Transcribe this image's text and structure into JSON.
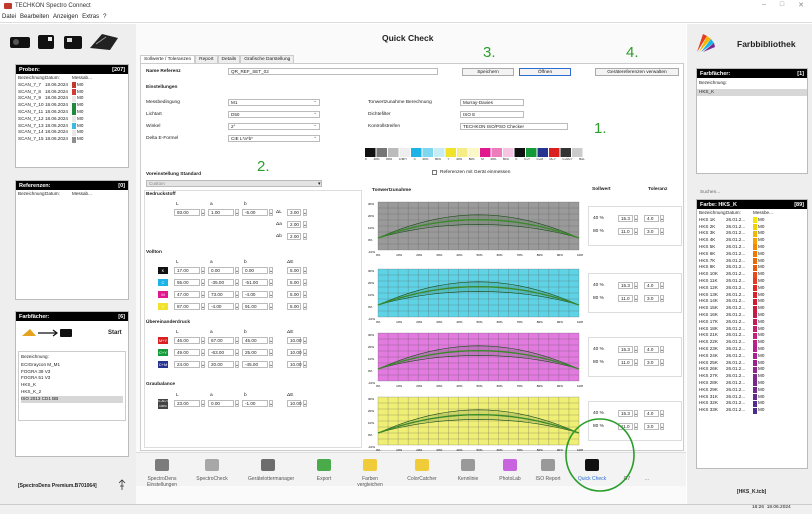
{
  "app": {
    "title": "TECHKON Spectro Connect",
    "menu": [
      "Datei",
      "Bearbeiten",
      "Anzeigen",
      "Extras",
      "?"
    ]
  },
  "left": {
    "probes_header": "Proben:",
    "probes_count": "[207]",
    "cols": [
      "Bezeichnung:",
      "Datum:",
      "Messab..."
    ],
    "probes": [
      [
        "SCAN_7_7",
        "18.06.2024",
        "#c0392b",
        "M0"
      ],
      [
        "SCAN_7_8",
        "18.06.2024",
        "#d23a3a",
        "M0"
      ],
      [
        "SCAN_7_9",
        "18.06.2024",
        "#e8e8e8",
        "M0"
      ],
      [
        "SCAN_7_10",
        "18.06.2024",
        "#1f8a3a",
        "M0"
      ],
      [
        "SCAN_7_11",
        "18.06.2024",
        "#1f8a3a",
        "M0"
      ],
      [
        "SCAN_7_12",
        "18.06.2024",
        "#e8e8e8",
        "M0"
      ],
      [
        "SCAN_7_13",
        "18.06.2024",
        "#3bb9e0",
        "M0"
      ],
      [
        "SCAN_7_14",
        "18.06.2024",
        "#e8e8e8",
        "M0"
      ],
      [
        "SCAN_7_15",
        "18.06.2024",
        "#8f8f8f",
        "M0"
      ]
    ],
    "refs_header": "Referenzen:",
    "refs_count": "[0]",
    "fan_header": "Farbfächer:",
    "fan_count": "[6]",
    "start": "Start",
    "fan_col": "Bezeichnung:",
    "fans": [
      "ECIGraycon M_M1",
      "FOGRA 39 V3",
      "FOGRA 51 V3",
      "HKS_K",
      "HKS_K_2",
      "ISO 2013 CD1 BB"
    ],
    "device": "[SpectroDens Premium.B701064]"
  },
  "main": {
    "title": "Quick Check",
    "tabs": [
      "Sollwerte / Toleranzen",
      "Report",
      "Details",
      "Grafische Darstellung"
    ],
    "name_ref_label": "Name Referenz",
    "name_ref_value": "QR_REF_SET_02",
    "btn_save": "Speichern",
    "btn_open": "Öffnen",
    "btn_device": "Gerätereferenzen verwalten",
    "settings": "Einstellungen",
    "rows": [
      [
        "Messbedingung",
        "M1"
      ],
      [
        "Lichtart",
        "D50"
      ],
      [
        "Winkel",
        "2°"
      ],
      [
        "Delta E-Formel",
        "CIE L*a*b*"
      ]
    ],
    "rrows": [
      [
        "Tonwertzunahme Berechnung",
        "Murray-Davies"
      ],
      [
        "Dichtefilter",
        "ISO E"
      ],
      [
        "Kontrollstreifen",
        "TECHKON ISO/PSO Checker"
      ]
    ],
    "strip_labels": [
      "K",
      "40%",
      "80%",
      "C/M/Y",
      "C",
      "40%",
      "80%",
      "Y",
      "40%",
      "80%",
      "M",
      "40%",
      "80%",
      "K",
      "C+Y",
      "C+M",
      "M+Y",
      "C+M+Y",
      "BAL"
    ],
    "preset_label": "Voreinstellung Standard",
    "preset_value": "Custom",
    "ref_device_check": "Referenzen mit Gerät einmessen",
    "sections": {
      "paper": {
        "title": "Bedruckstoff",
        "cols": [
          "L",
          "a",
          "b"
        ],
        "vals": [
          "93.00",
          "1.00",
          "-5.00"
        ],
        "dl_label": "ΔL",
        "dl": "3.00",
        "da_label": "Δa",
        "da": "2.00",
        "db_label": "Δb",
        "db": "2.00"
      },
      "solid": {
        "title": "Vollton",
        "cols": [
          "L",
          "a",
          "b",
          "ΔE"
        ],
        "rows": [
          [
            "K",
            "17.00",
            "0.00",
            "0.00",
            "5.00",
            "#111111"
          ],
          [
            "C",
            "55.00",
            "-35.00",
            "-51.00",
            "5.00",
            "#1cb4e6"
          ],
          [
            "M",
            "47.00",
            "73.00",
            "-4.00",
            "5.00",
            "#e0198f"
          ],
          [
            "Y",
            "87.00",
            "-4.00",
            "91.00",
            "5.00",
            "#f2e22a"
          ]
        ]
      },
      "over": {
        "title": "Übereinanderdruck",
        "cols": [
          "L",
          "a",
          "b",
          "ΔE"
        ],
        "rows": [
          [
            "M+Y",
            "46.00",
            "67.00",
            "45.00",
            "10.00",
            "#d91f1f"
          ],
          [
            "C+Y",
            "49.00",
            "-63.00",
            "25.00",
            "10.00",
            "#159a3a"
          ],
          [
            "C+M",
            "24.00",
            "20.00",
            "-45.00",
            "10.00",
            "#26338f"
          ]
        ]
      },
      "gray": {
        "title": "Graubalance",
        "cols": [
          "L",
          "a",
          "b",
          "ΔE"
        ],
        "chip": "C+M+Y 100%",
        "vals": [
          "23.00",
          "0.00",
          "-1.00",
          "10.00"
        ]
      }
    },
    "tvz_title": "Tonwertzunahme",
    "sollwert": "Sollwert",
    "toleranz": "Toleranz",
    "tvz": [
      [
        "40 %",
        "15.3",
        "4.0",
        "80 %",
        "11.0",
        "3.0"
      ],
      [
        "40 %",
        "15.3",
        "4.0",
        "80 %",
        "11.0",
        "3.0"
      ],
      [
        "40 %",
        "15.3",
        "4.0",
        "80 %",
        "11.0",
        "3.0"
      ],
      [
        "40 %",
        "15.3",
        "4.0",
        "80 %",
        "11.0",
        "3.0"
      ]
    ],
    "chart_ticks_x": [
      "0%",
      "10%",
      "20%",
      "30%",
      "40%",
      "50%",
      "60%",
      "70%",
      "80%",
      "90%",
      "100%"
    ],
    "chart_ticks_y": [
      "30%",
      "20%",
      "10%",
      "0%",
      "-10%"
    ],
    "chart_colors": [
      "#9a9a9a",
      "#5fd3e6",
      "#e27ae0",
      "#f0ef75"
    ],
    "markers": [
      "1.",
      "2.",
      "3.",
      "4."
    ]
  },
  "toolbar": [
    "SpectroDens Einstellungen",
    "SpectroCheck",
    "Gerätelottermanager",
    "Export",
    "Farben vergleichen",
    "ColorCatcher",
    "Kennlinie",
    "PhotoLab",
    "ISO Report",
    "Quick Check",
    "G7",
    "..."
  ],
  "right": {
    "title": "Farbbibliothek",
    "fan_header": "Farbfächer:",
    "fan_count": "[1]",
    "fan_col": "Bezeichnung:",
    "fan_item": "HKS_K",
    "search_label": "Suchen...",
    "color_header": "Farbe: HKS_K",
    "color_count": "[89]",
    "cols": [
      "Bezeichnung:",
      "Datum:",
      "Messbe..."
    ],
    "colors": [
      [
        "HKS 1K",
        "26.01.2...",
        "#f7e400",
        "M0"
      ],
      [
        "HKS 2K",
        "26.01.2...",
        "#f3d100",
        "M0"
      ],
      [
        "HKS 3K",
        "26.01.2...",
        "#f5b700",
        "M0"
      ],
      [
        "HKS 4K",
        "26.01.2...",
        "#f7a000",
        "M0"
      ],
      [
        "HKS 5K",
        "26.01.2...",
        "#f28a00",
        "M0"
      ],
      [
        "HKS 6K",
        "26.01.2...",
        "#ef7a00",
        "M0"
      ],
      [
        "HKS 7K",
        "26.01.2...",
        "#ea6a00",
        "M0"
      ],
      [
        "HKS 8K",
        "26.01.2...",
        "#e85c0c",
        "M0"
      ],
      [
        "HKS 10K",
        "26.01.2...",
        "#e84b1a",
        "M0"
      ],
      [
        "HKS 11K",
        "26.01.2...",
        "#e53d23",
        "M0"
      ],
      [
        "HKS 12K",
        "26.01.2...",
        "#df2a26",
        "M0"
      ],
      [
        "HKS 13K",
        "26.01.2...",
        "#d8222c",
        "M0"
      ],
      [
        "HKS 14K",
        "26.01.2...",
        "#cf1e34",
        "M0"
      ],
      [
        "HKS 15K",
        "26.01.2...",
        "#c81d3f",
        "M0"
      ],
      [
        "HKS 16K",
        "26.01.2...",
        "#c11c4a",
        "M0"
      ],
      [
        "HKS 17K",
        "26.01.2...",
        "#c21d59",
        "M0"
      ],
      [
        "HKS 18K",
        "26.01.2...",
        "#c51e6b",
        "M0"
      ],
      [
        "HKS 21K",
        "26.01.2...",
        "#c41f7d",
        "M0"
      ],
      [
        "HKS 22K",
        "26.01.2...",
        "#bd1f8b",
        "M0"
      ],
      [
        "HKS 23K",
        "26.01.2...",
        "#b5208f",
        "M0"
      ],
      [
        "HKS 24K",
        "26.01.2...",
        "#a9218f",
        "M0"
      ],
      [
        "HKS 25K",
        "26.01.2...",
        "#9b238f",
        "M0"
      ],
      [
        "HKS 26K",
        "26.01.2...",
        "#90258f",
        "M0"
      ],
      [
        "HKS 27K",
        "26.01.2...",
        "#852690",
        "M0"
      ],
      [
        "HKS 28K",
        "26.01.2...",
        "#7a2790",
        "M0"
      ],
      [
        "HKS 29K",
        "26.01.2...",
        "#6e2890",
        "M0"
      ],
      [
        "HKS 31K",
        "26.01.2...",
        "#62298f",
        "M0"
      ],
      [
        "HKS 32K",
        "26.01.2...",
        "#572a8f",
        "M0"
      ],
      [
        "HKS 33K",
        "26.01.2...",
        "#4b2b8e",
        "M0"
      ]
    ],
    "ref_file": "[HKS_K.tcb]"
  },
  "status": {
    "time": "16:26",
    "date": "18.06.2024"
  }
}
